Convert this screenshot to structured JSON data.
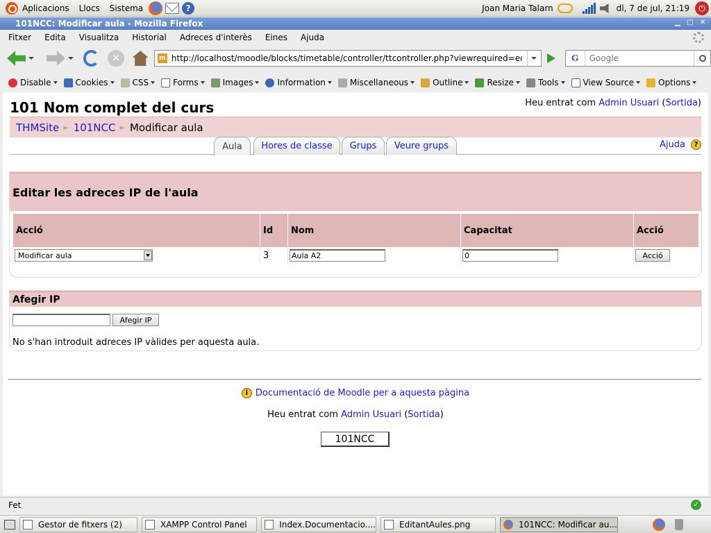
{
  "gnome_panel": {
    "menus": [
      "Aplicacions",
      "Llocs",
      "Sistema"
    ],
    "user": "Joan Maria Talarn",
    "clock": "dl,  7 de jul, 21:19"
  },
  "window": {
    "title": "101NCC: Modificar aula - Mozilla Firefox"
  },
  "menubar": [
    "Fitxer",
    "Edita",
    "Visualitza",
    "Historial",
    "Adreces d'interès",
    "Eines",
    "Ajuda"
  ],
  "navbar": {
    "url": "http://localhost/moodle/blocks/timetable/controller/ttcontroller.php?viewrequired=editcla",
    "search_placeholder": "Google"
  },
  "webdev_toolbar": [
    "Disable",
    "Cookies",
    "CSS",
    "Forms",
    "Images",
    "Information",
    "Miscellaneous",
    "Outline",
    "Resize",
    "Tools",
    "View Source",
    "Options"
  ],
  "page": {
    "course_title": "101 Nom complet del curs",
    "login_prefix": "Heu entrat com",
    "user_link": "Admin Usuari",
    "logout_link": "Sortida",
    "breadcrumb": [
      "THMSite",
      "101NCC",
      "Modificar aula"
    ],
    "tabs": [
      "Aula",
      "Hores de classe",
      "Grups",
      "Veure grups"
    ],
    "help": "Ajuda",
    "edit_box": {
      "title": "Editar les adreces IP de l'aula",
      "columns": [
        "Acció",
        "Id",
        "Nom",
        "Capacitat",
        "Acció"
      ],
      "row": {
        "action": "Modificar aula",
        "id": "3",
        "name": "Aula A2",
        "capacity": "0",
        "button": "Acció"
      }
    },
    "ip_box": {
      "title": "Afegir IP",
      "ip_value": "",
      "button": "Afegir IP",
      "message": "No s'han introduit adreces IP vàlides per aquesta aula."
    },
    "doc_link": "Documentació de Moodle per a aquesta pàgina",
    "home_button": "101NCC"
  },
  "statusbar": {
    "text": "Fet"
  },
  "taskbar": [
    "Gestor de fitxers (2)",
    "XAMPP Control Panel",
    "Index.Documentacio....",
    "EditantAules.png",
    "101NCC: Modificar au..."
  ]
}
